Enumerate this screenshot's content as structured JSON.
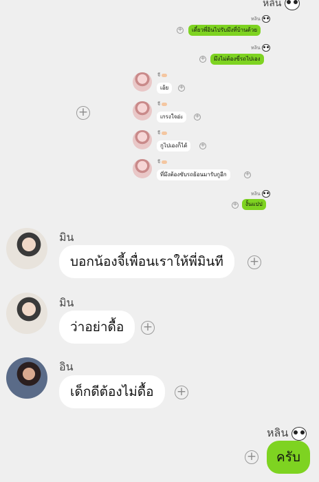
{
  "sender_me_name": "หลิน",
  "top_partial_name": "หลิน",
  "msgs_me_small": [
    "เดี๋ยวพี่อินไปรับมึงที่บ้านด้วย",
    "มึงไม่ต้องขี่รถไปเอง"
  ],
  "sender_ji_name": "จี",
  "msgs_ji_small": [
    "เอ้ย",
    "เกรงใจอ่ะ",
    "กูไปเองก็ได้",
    "ที่มึงต้องขับรถย้อนมารับกูอีก"
  ],
  "msg_me_small_last": "งั้นแปป",
  "sender_min_name": "มิน",
  "msg_min_1": "บอกน้องจี้เพื่อนเราให้พี่มินที",
  "msg_min_2": "ว่าอย่าดื้อ",
  "sender_in_name": "อิน",
  "msg_in_1": "เด็กดีต้องไม่ดื้อ",
  "msg_me_big": "ครับ",
  "icons": {
    "add": "plus-circle-icon",
    "sticker": "panda-icon"
  },
  "colors": {
    "background": "#efefef",
    "my_bubble": "#7ed321",
    "their_bubble": "#ffffff"
  }
}
